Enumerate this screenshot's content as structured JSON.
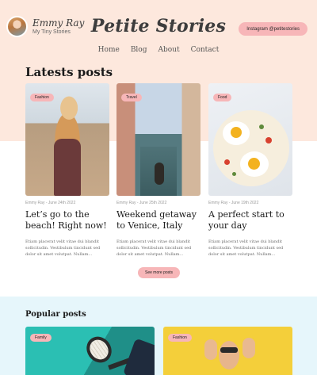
{
  "brand": {
    "name": "Emmy Ray",
    "tagline": "My Tiny Stories"
  },
  "site_title": "Petite Stories",
  "instagram_button": "Instagram @petitestories",
  "nav": [
    "Home",
    "Blog",
    "About",
    "Contact"
  ],
  "latest": {
    "heading": "Latests posts",
    "posts": [
      {
        "tag": "Fashion",
        "meta": "Emmy Ray - June 24th 2022",
        "title": "Let’s go to the beach! Right now!",
        "excerpt": "Etiam placerat velit vitae dui blandit sollicitudin. Vestibulum tincidunt sed dolor sit amet volutpat. Nullam..."
      },
      {
        "tag": "Travel",
        "meta": "Emmy Ray - June 25th 2022",
        "title": "Weekend getaway to Venice, Italy",
        "excerpt": "Etiam placerat velit vitae dui blandit sollicitudin. Vestibulum tincidunt sed dolor sit amet volutpat. Nullam..."
      },
      {
        "tag": "Food",
        "meta": "Emmy Ray - June 19th 2022",
        "title": "A perfect start to your day",
        "excerpt": "Etiam placerat velit vitae dui blandit sollicitudin. Vestibulum tincidunt sed dolor sit amet volutpat. Nullam..."
      }
    ],
    "see_more": "See more posts"
  },
  "popular": {
    "heading": "Popular posts",
    "posts": [
      {
        "tag": "Family"
      },
      {
        "tag": "Fashion"
      }
    ]
  },
  "colors": {
    "hero_background": "#fde8dd",
    "popular_background": "#e6f6fb",
    "accent_pink": "#f7b6b8"
  }
}
